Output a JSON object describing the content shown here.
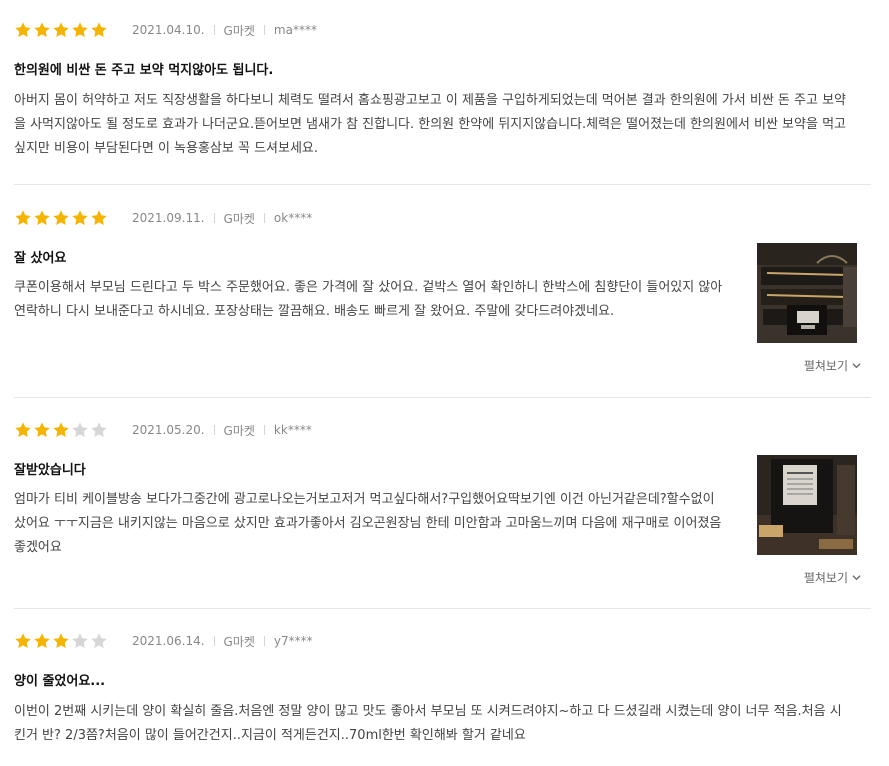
{
  "colors": {
    "star_on": "#f5b400",
    "star_off": "#d6d6d6"
  },
  "reviews": [
    {
      "rating": 5,
      "date": "2021.04.10.",
      "source": "G마켓",
      "user": "ma****",
      "title": "한의원에 비싼 돈 주고 보약 먹지않아도 됩니다.",
      "body": "아버지 몸이 허약하고 저도 직장생활을 하다보니 체력도 떨려서 홈쇼핑광고보고 이 제품을 구입하게되었는데 먹어본 결과 한의원에 가서 비싼 돈 주고 보약을 사먹지않아도 될 정도로 효과가 나더군요.뜯어보면 냄새가 참 진합니다. 한의원 한약에 뒤지지않습니다.체력은 떨어졌는데 한의원에서 비싼 보약을 먹고싶지만 비용이 부담된다면 이 녹용홍삼보 꼭 드셔보세요."
    },
    {
      "rating": 5,
      "date": "2021.09.11.",
      "source": "G마켓",
      "user": "ok****",
      "title": "잘 샀어요",
      "body": "쿠폰이용해서 부모님 드린다고 두 박스 주문했어요. 좋은 가격에 잘 샀어요. 겉박스 열어 확인하니 한박스에 침향단이 들어있지 않아 연락하니 다시 보내준다고 하시네요. 포장상태는 깔끔해요. 배송도 빠르게 잘 왔어요. 주말에 갖다드려야겠네요.",
      "expand": "펼쳐보기"
    },
    {
      "rating": 3,
      "date": "2021.05.20.",
      "source": "G마켓",
      "user": "kk****",
      "title": "잘받았습니다",
      "body": "엄마가 티비 케이블방송 보다가그중간에 광고로나오는거보고저거 먹고싶다해서?구입했어요딱보기엔 이건 아닌거같은데?할수없이 샀어요 ㅜㅜ지금은 내키지않는 마음으로 샀지만 효과가좋아서 김오곤원장님 한테 미안함과 고마움느끼며 다음에 재구매로 이어졌음좋겠어요",
      "expand": "펼쳐보기"
    },
    {
      "rating": 3,
      "date": "2021.06.14.",
      "source": "G마켓",
      "user": "y7****",
      "title": "양이 줄었어요...",
      "body": "이번이 2번째 시키는데 양이 확실히 줄음.처음엔 정말 양이 많고 맛도 좋아서 부모님 또 시켜드려야지~하고 다 드셨길래 시켰는데 양이 너무 적음.처음 시킨거 반? 2/3쯤?처음이 많이 들어간건지..지금이 적게든건지..70ml한번 확인해봐 할거 같네요"
    }
  ]
}
